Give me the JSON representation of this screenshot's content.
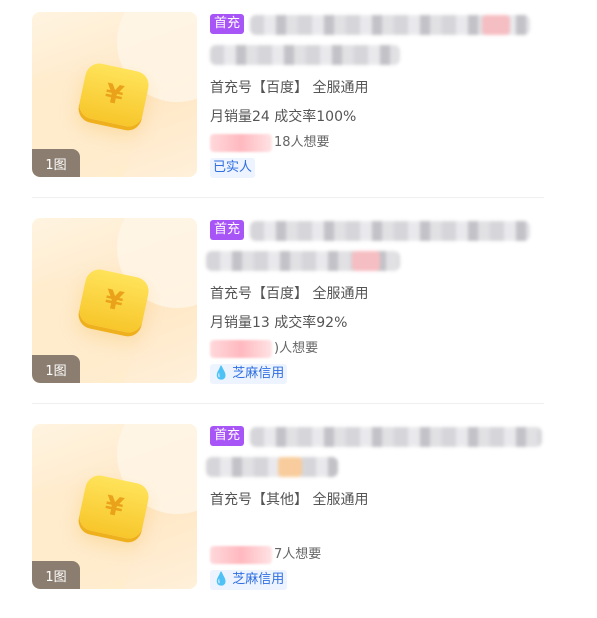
{
  "listings": [
    {
      "image_count": "1图",
      "coin_symbol": "¥",
      "badge": "首充",
      "desc": "首充号【百度】 全服通用",
      "sales": "月销量24 成交率100%",
      "want": "18人想要",
      "tag_icon": "verified-none",
      "tag": "已实人"
    },
    {
      "image_count": "1图",
      "coin_symbol": "¥",
      "badge": "首充",
      "desc": "首充号【百度】 全服通用",
      "sales": "月销量13 成交率92%",
      "want": ")人想要",
      "tag_icon": "drop-icon",
      "tag": "芝麻信用"
    },
    {
      "image_count": "1图",
      "coin_symbol": "¥",
      "badge": "首充",
      "desc": "首充号【其他】 全服通用",
      "sales": "",
      "want": "7人想要",
      "tag_icon": "drop-icon",
      "tag": "芝麻信用"
    }
  ],
  "colors": {
    "badge": "#a855f7",
    "tag_text": "#2f6fe0",
    "tag_bg": "#eef4ff"
  }
}
